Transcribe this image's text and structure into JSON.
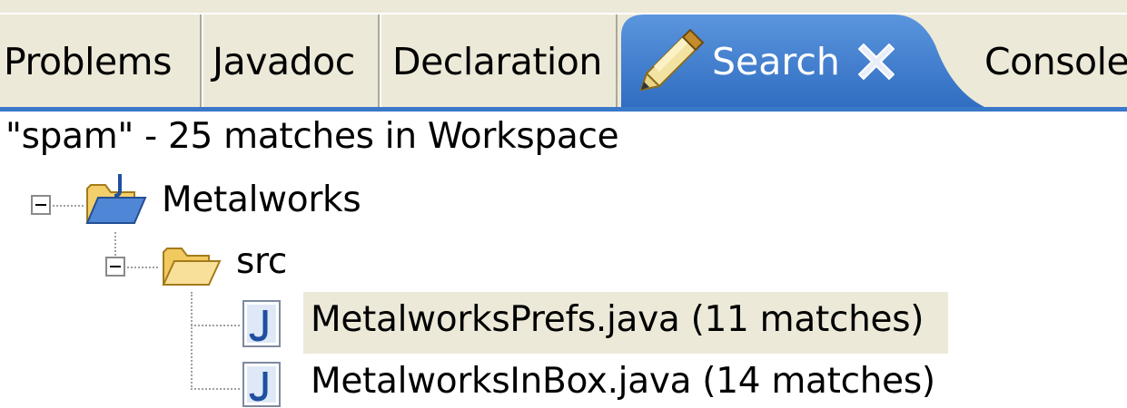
{
  "tabs": [
    {
      "label": "Problems"
    },
    {
      "label": "Javadoc"
    },
    {
      "label": "Declaration"
    },
    {
      "label": "Search",
      "icon": "search-pen-icon",
      "active": true
    },
    {
      "label": "Console"
    }
  ],
  "status": {
    "text": "\"spam\" - 25 matches in Workspace"
  },
  "tree": {
    "project": {
      "label": "Metalworks",
      "icon": "java-project-folder-icon",
      "expanded": true
    },
    "folder": {
      "label": "src",
      "icon": "open-folder-icon",
      "expanded": true
    },
    "files": [
      {
        "label": "MetalworksPrefs.java (11 matches)",
        "icon": "java-file-icon",
        "selected": true
      },
      {
        "label": "MetalworksInBox.java (14 matches)",
        "icon": "java-file-icon",
        "selected": false
      }
    ]
  },
  "colors": {
    "active_tab": "#3a78c9",
    "inactive_tab": "#ece9d8",
    "selection": "#ece9d8"
  }
}
